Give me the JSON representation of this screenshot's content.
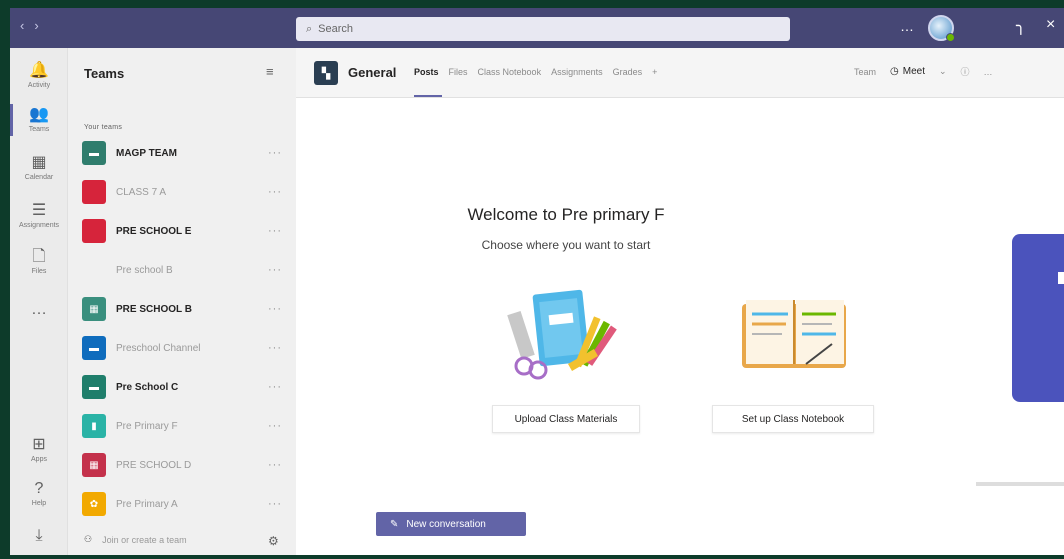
{
  "titlebar": {
    "search_placeholder": "Search",
    "nav_back": "‹",
    "nav_forward": "›",
    "more": "…",
    "minimize": "╮",
    "close": "×"
  },
  "appbar": {
    "items": [
      {
        "label": "Activity",
        "icon": "bell-icon",
        "glyph": "🔔"
      },
      {
        "label": "Teams",
        "icon": "teams-icon",
        "glyph": "👥"
      },
      {
        "label": "Calendar",
        "icon": "calendar-icon",
        "glyph": "▦"
      },
      {
        "label": "Assignments",
        "icon": "assignments-icon",
        "glyph": "☰"
      },
      {
        "label": "Files",
        "icon": "files-icon",
        "glyph": "🗋"
      },
      {
        "label": "",
        "icon": "more-apps-icon",
        "glyph": "…"
      },
      {
        "label": "Apps",
        "icon": "apps-icon",
        "glyph": "⊞"
      },
      {
        "label": "Help",
        "icon": "help-icon",
        "glyph": "?"
      },
      {
        "label": "",
        "icon": "download-icon",
        "glyph": "⤓"
      }
    ]
  },
  "teams_panel": {
    "title": "Teams",
    "section_label": "Your teams",
    "teams": [
      {
        "name": "MAGP TEAM",
        "color": "#2f7d6d",
        "style": "bold"
      },
      {
        "name": "CLASS 7 A",
        "color": "#d6243b",
        "style": "faint"
      },
      {
        "name": "PRE SCHOOL E",
        "color": "#d6243b",
        "style": "bold"
      },
      {
        "name": "Pre school B",
        "color": "#f0f0f0",
        "style": "faint"
      },
      {
        "name": "PRE SCHOOL B",
        "color": "#3a8f7e",
        "style": "bold"
      },
      {
        "name": "Preschool Channel",
        "color": "#0f6cbd",
        "style": "faint"
      },
      {
        "name": "Pre School C",
        "color": "#1f7e6b",
        "style": "bold"
      },
      {
        "name": "Pre Primary F",
        "color": "#2ab3a6",
        "style": "faint"
      },
      {
        "name": "PRE SCHOOL D",
        "color": "#c4314b",
        "style": "faint"
      },
      {
        "name": "Pre Primary A",
        "color": "#f2a900",
        "style": "faint"
      }
    ],
    "join_label": "Join or create a team"
  },
  "channel": {
    "name": "General",
    "tabs": [
      {
        "label": "Posts",
        "active": true
      },
      {
        "label": "Files",
        "active": false
      },
      {
        "label": "Class Notebook",
        "active": false
      },
      {
        "label": "Assignments",
        "active": false
      },
      {
        "label": "Grades",
        "active": false
      },
      {
        "label": "+",
        "active": false
      }
    ],
    "team_label": "Team",
    "meet_label": "Meet",
    "meet_dropdown": "⌄"
  },
  "welcome": {
    "title": "Welcome to Pre primary F",
    "subtitle": "Choose where you want to start",
    "upload_label": "Upload Class Materials",
    "notebook_label": "Set up Class Notebook"
  },
  "compose": {
    "new_conversation": "New conversation"
  },
  "colors": {
    "titlebar": "#464775",
    "accent": "#6264a7",
    "side_card": "#4b53bc"
  }
}
